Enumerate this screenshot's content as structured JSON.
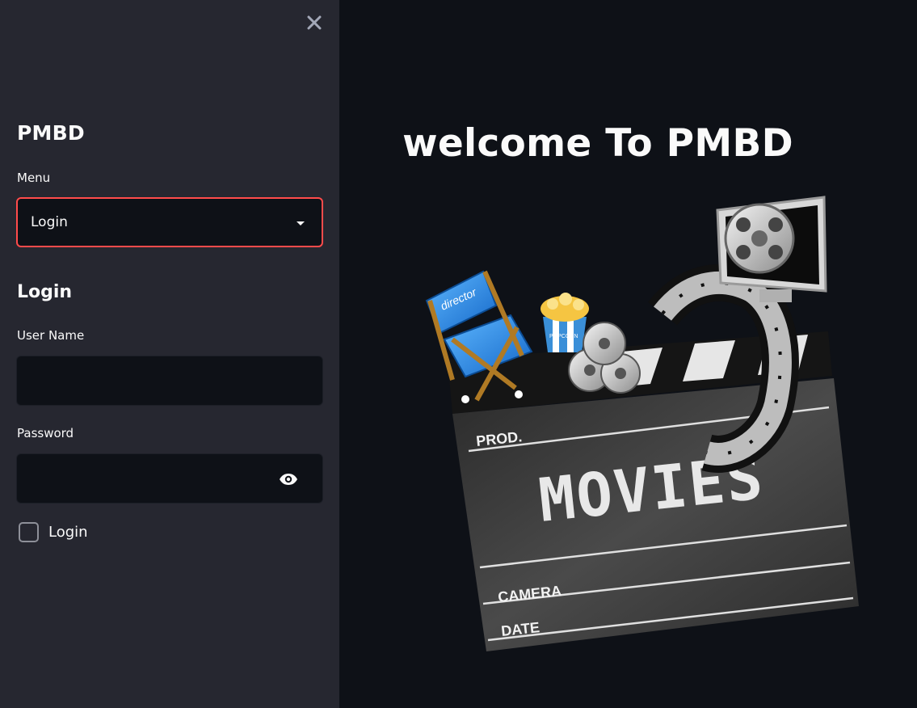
{
  "sidebar": {
    "title": "PMBD",
    "menu_label": "Menu",
    "menu_selected": "Login",
    "menu_options": [
      "Login"
    ],
    "subheader": "Login",
    "username_label": "User Name",
    "username_value": "",
    "password_label": "Password",
    "password_value": "",
    "checkbox_label": "Login",
    "checkbox_checked": false
  },
  "main": {
    "title": "welcome To PMBD",
    "hero": {
      "director_text": "director",
      "popcorn_text": "POPCORN",
      "prod_text": "PROD.",
      "movies_text": "MOVIES",
      "camera_text": "CAMERA",
      "date_text": "DATE"
    }
  },
  "colors": {
    "sidebar_bg": "#262730",
    "main_bg": "#0e1117",
    "accent": "#ff4b4b",
    "text": "#fafafa"
  },
  "icons": [
    "close-icon",
    "caret-down-icon",
    "eye-icon"
  ]
}
